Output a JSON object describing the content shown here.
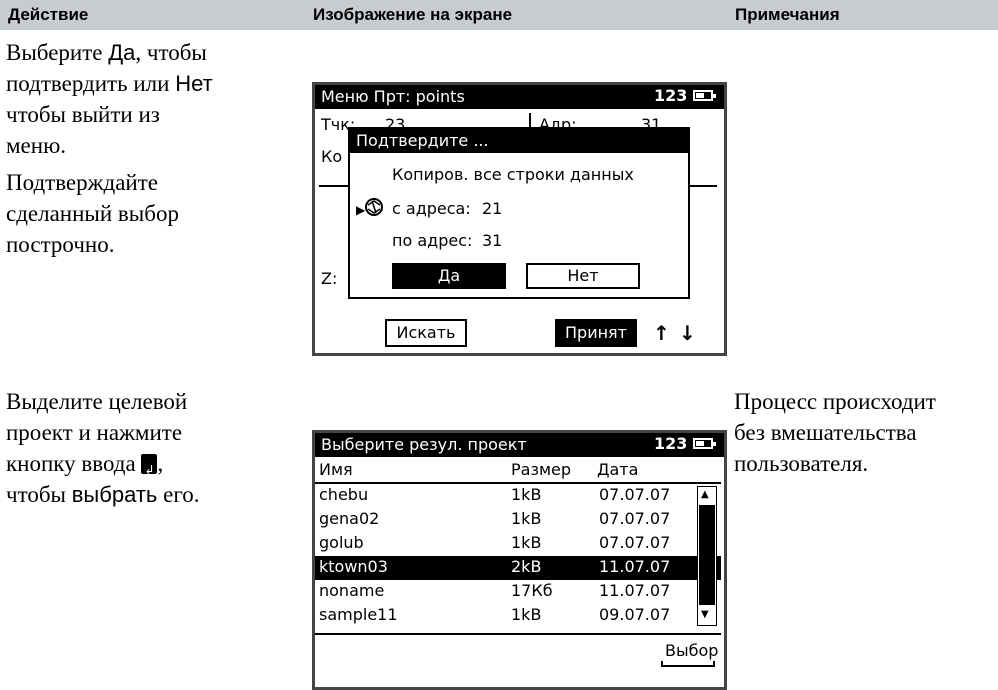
{
  "header": {
    "action": "Действие",
    "screen": "Изображение на экране",
    "notes": "Примечания"
  },
  "row1": {
    "p1_lines": [
      "подтвердить или",
      "чтобы выйти из",
      "меню."
    ],
    "p1_start": "Выберите ",
    "p1_yes": "Да",
    "p1_mid": ", чтобы",
    "p1_no": "Нет",
    "p2_lines": [
      "Подтверждайте",
      "сделанный выбор",
      "построчно."
    ],
    "screen": {
      "title": "Меню  Прт: points",
      "mode": "123",
      "bg_left1": "Тчк:",
      "bg_val1": "23",
      "bg_right1": "Адр:",
      "bg_rval1": "31",
      "bg_left2": "Ко",
      "bg_z": "Z:",
      "dialog_title": "Подтвердите ...",
      "dialog_line1": "Копиров. все строки данных",
      "dialog_from_label": "с адреса:",
      "dialog_from_val": "21",
      "dialog_to_label": "по адрес:",
      "dialog_to_val": "31",
      "yes": "Да",
      "no": "Нет",
      "search": "Искать",
      "accept": "Принят",
      "arrow_up": "↑",
      "arrow_down": "↓"
    }
  },
  "row2": {
    "lines": [
      "Выделите целевой",
      "проект и нажмите",
      "чтобы"
    ],
    "line3_prefix": "кнопку ввода",
    "select_word": "выбрать",
    "select_suffix": " его.",
    "note_lines": [
      "Процесс происходит",
      "без вмешательства",
      "пользователя."
    ],
    "screen": {
      "title": "Выберите резул. проект",
      "mode": "123",
      "col_name": "Имя",
      "col_size": "Размер",
      "col_date": "Дата",
      "rows": [
        {
          "name": "chebu",
          "size": "1kB",
          "date": "07.07.07"
        },
        {
          "name": "gena02",
          "size": "1kB",
          "date": "07.07.07"
        },
        {
          "name": "golub",
          "size": "1kB",
          "date": "07.07.07"
        },
        {
          "name": "ktown03",
          "size": "2kB",
          "date": "11.07.07"
        },
        {
          "name": "noname",
          "size": "17Кб",
          "date": "11.07.07"
        },
        {
          "name": "sample11",
          "size": "1kB",
          "date": "09.07.07"
        }
      ],
      "selected_index": 3,
      "select_btn": "Выбор"
    }
  }
}
